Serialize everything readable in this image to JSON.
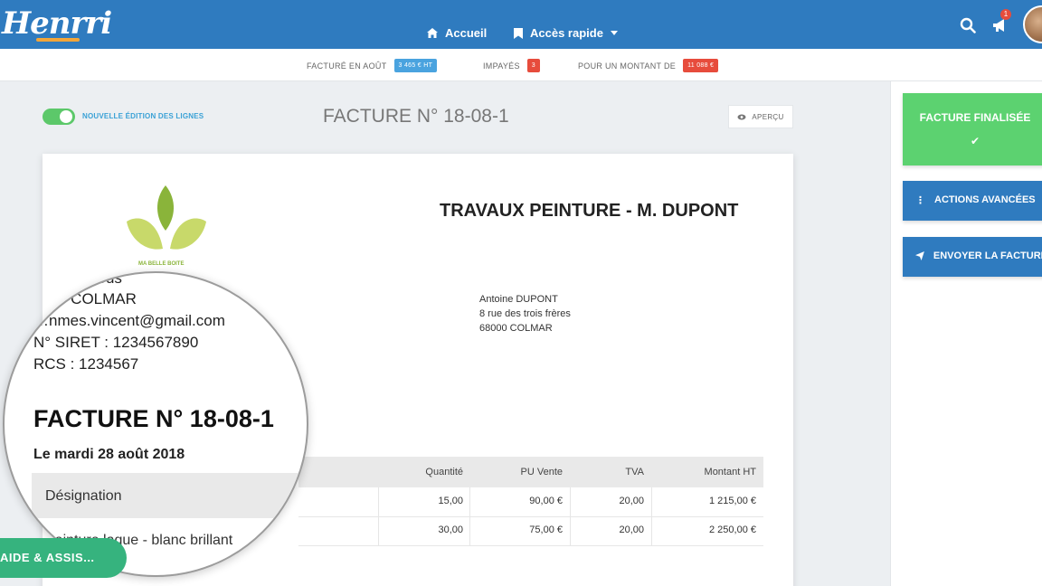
{
  "app": {
    "logo": "Henrri"
  },
  "nav": {
    "home_label": "Accueil",
    "quick_access_label": "Accès rapide",
    "notification_count": "1"
  },
  "stats": {
    "invoiced_label": "FACTURÉ EN AOÛT",
    "invoiced_value": "3 465 € HT",
    "unpaid_label": "IMPAYÉS",
    "unpaid_value": "3",
    "amount_label": "POUR UN MONTANT DE",
    "amount_value": "11 088 €"
  },
  "editor": {
    "toggle_label": "NOUVELLE ÉDITION DES LIGNES",
    "toggle_on": true,
    "heading": "FACTURE N° 18-08-1",
    "preview_label": "APERÇU"
  },
  "invoice": {
    "company_name": "MA BELLE BOITE",
    "title": "TRAVAUX PEINTURE - M. DUPONT",
    "client": [
      "Antoine DUPONT",
      "8 rue des trois frères",
      "68000 COLMAR"
    ],
    "columns": [
      "Quantité",
      "PU Vente",
      "TVA",
      "Montant HT"
    ],
    "rows": [
      {
        "quantite": "15,00",
        "pu": "90,00 €",
        "tva": "20,00",
        "montant": "1 215,00 €"
      },
      {
        "quantite": "30,00",
        "pu": "75,00 €",
        "tva": "20,00",
        "montant": "2 250,00 €"
      }
    ]
  },
  "magnifier": {
    "address_fragment": "…is sous",
    "city": "…0 COLMAR",
    "email": "…nmes.vincent@gmail.com",
    "siret": "N° SIRET : 1234567890",
    "rcs": "RCS : 1234567",
    "title": "FACTURE N° 18-08-1",
    "date": "Le mardi 28 août 2018",
    "designation_header": "Désignation",
    "first_row": "Peinture laque - blanc brillant"
  },
  "help": {
    "label": "AIDE & ASSIS..."
  },
  "sidebar": {
    "finalized_label": "FACTURE FINALISÉE",
    "advanced_label": "ACTIONS AVANCÉES",
    "send_label": "ENVOYER LA FACTURE"
  },
  "colors": {
    "nav": "#2f7bbf",
    "success": "#5cd270",
    "accent": "#3aa1d6",
    "danger": "#e74c3c"
  }
}
